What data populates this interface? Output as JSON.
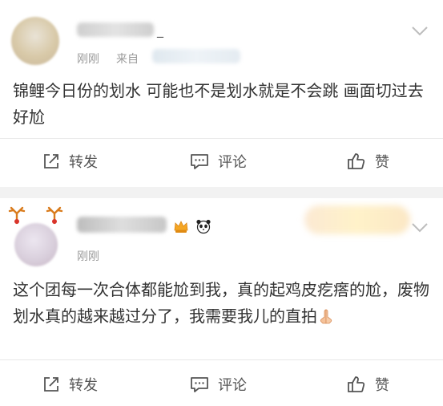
{
  "posts": [
    {
      "time": "刚刚",
      "source_prefix": "来自",
      "name_tail": "_",
      "text": "锦鲤今日份的划水 可能也不是划水就是不会跳 画面切过去 好尬",
      "actions": {
        "repost": "转发",
        "comment": "评论",
        "like": "赞"
      }
    },
    {
      "time": "刚刚",
      "text": "这个团每一次合体都能尬到我，真的起鸡皮疙瘩的尬，废物划水真的越来越过分了，我需要我儿的直拍",
      "actions": {
        "repost": "转发",
        "comment": "评论",
        "like": "赞"
      }
    }
  ],
  "icons": {
    "more": "chevron-down-icon",
    "repost": "share-icon",
    "comment": "comment-icon",
    "like": "thumbs-up-icon",
    "vip": "crown-icon",
    "fan_badge": "panda-icon",
    "emoji": "praying-hands-icon",
    "avatar_deco": "reindeer-antler-icon"
  },
  "colors": {
    "text": "#333333",
    "meta": "#9a9a9a",
    "divider": "#e8e8e8",
    "gap": "#f2f2f2",
    "crown": "#f5a623"
  }
}
